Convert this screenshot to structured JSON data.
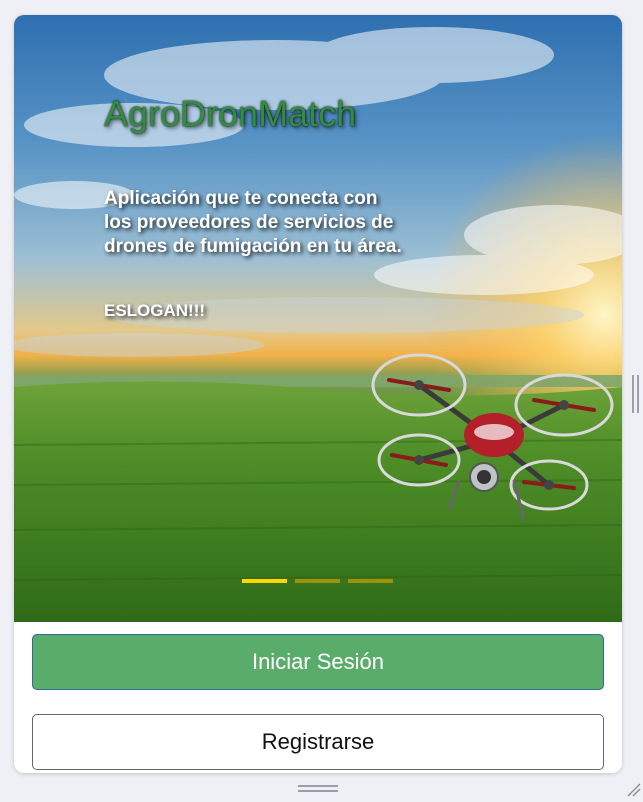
{
  "hero": {
    "title": "AgroDronMatch",
    "description": "Aplicación que te conecta con los proveedores de servicios de drones de fumigación en tu área.",
    "slogan": "ESLOGAN!!!",
    "background_image": "sunset-over-green-crop-field",
    "foreground_image": "agricultural-drone",
    "carousel": {
      "slides": 3,
      "active_index": 0
    }
  },
  "actions": {
    "login_label": "Iniciar Sesión",
    "register_label": "Registrarse"
  },
  "colors": {
    "title": "#2f8f3c",
    "login_button": "#5aac6a",
    "indicator_active": "#ffd700",
    "indicator_inactive": "#b89a00",
    "page_background": "#eef0f5"
  }
}
